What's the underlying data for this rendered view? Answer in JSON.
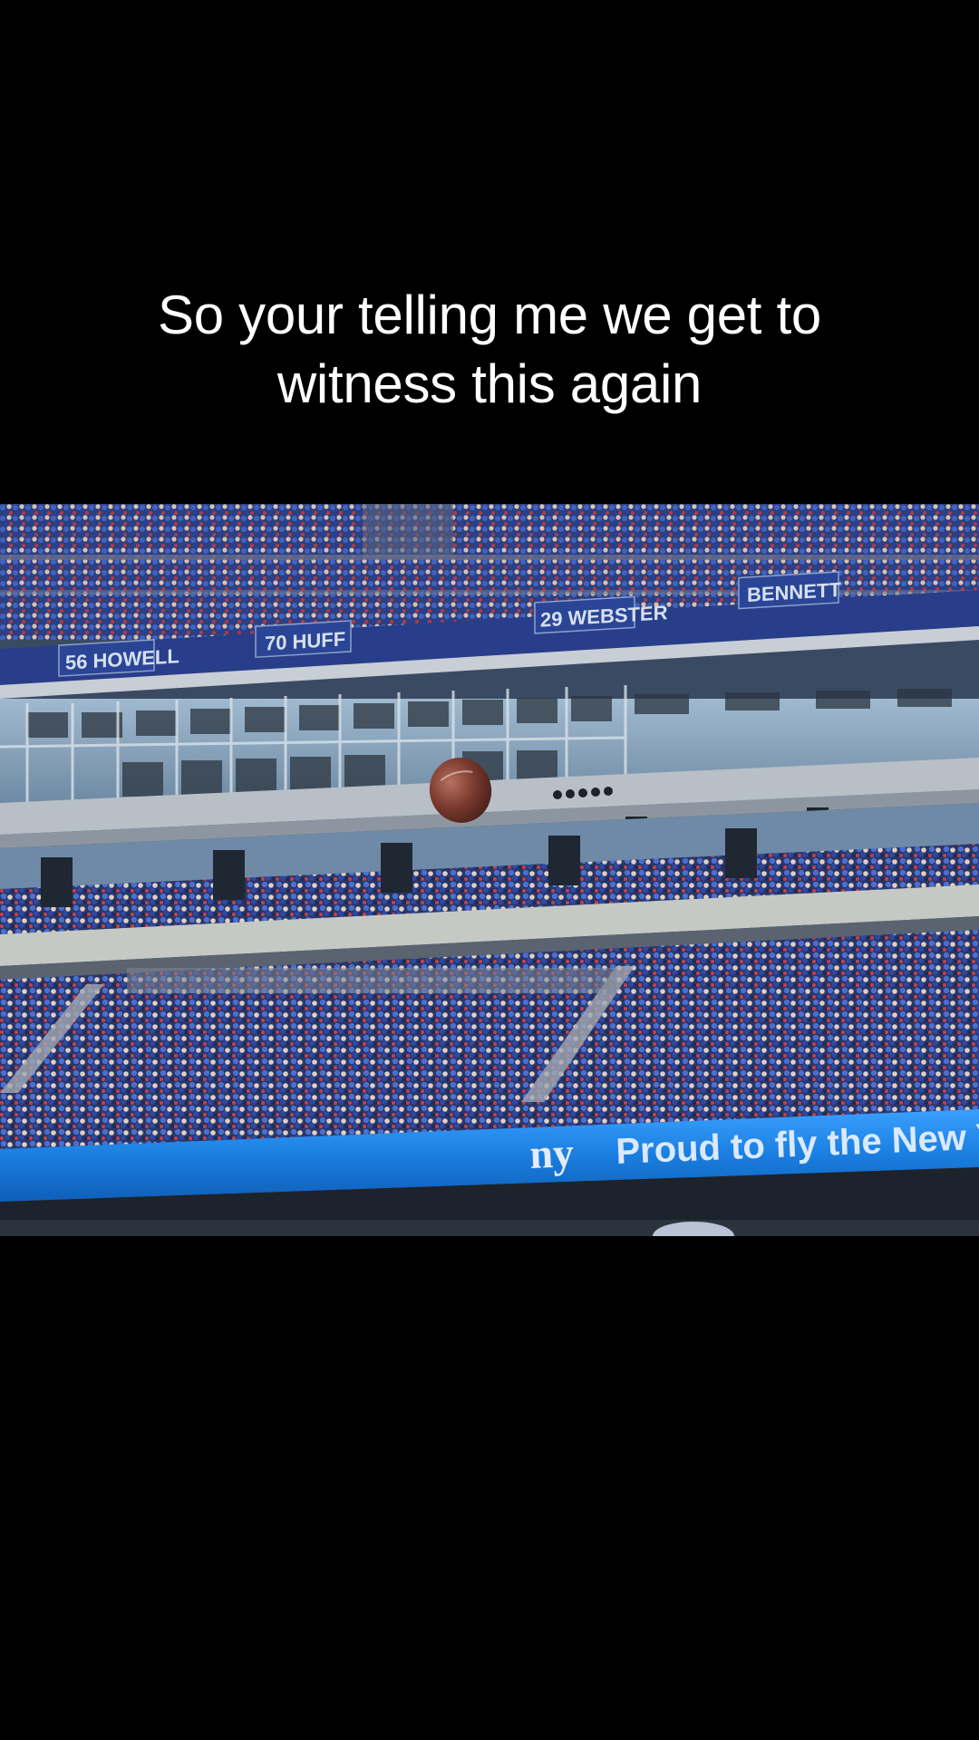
{
  "caption": {
    "line1": "So your telling me we get to",
    "line2": "witness this again"
  },
  "video": {
    "subject": "football-in-flight",
    "scene": "stadium-stands",
    "ribbon_logo": "ny",
    "ribbon_text": "Proud to fly the New Yo",
    "nameplates": [
      "56 HOWELL",
      "70 HUFF",
      "29 WEBSTER",
      "BENNETT"
    ],
    "colors": {
      "ribbon_blue": "#1a7ee0",
      "crowd_blue": "#2c4fa8",
      "background": "#000000",
      "caption_text": "#ffffff"
    }
  }
}
